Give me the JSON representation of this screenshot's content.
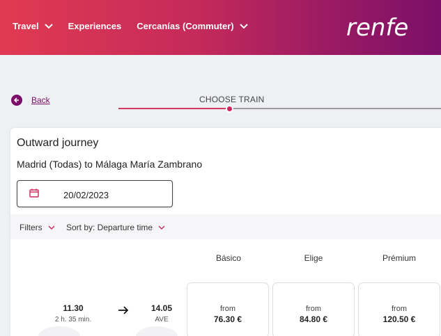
{
  "nav": {
    "items": [
      {
        "label": "Travel",
        "has_dropdown": true
      },
      {
        "label": "Experiences",
        "has_dropdown": false
      },
      {
        "label": "Cercanías (Commuter)",
        "has_dropdown": true
      }
    ],
    "logo": "renfe"
  },
  "progress": {
    "back_label": "Back",
    "step_title": "CHOOSE TRAIN"
  },
  "journey": {
    "title": "Outward journey",
    "route": "Madrid (Todas) to Málaga María Zambrano",
    "date": "20/02/2023"
  },
  "filters": {
    "filters_label": "Filters",
    "sort_label": "Sort by: Departure time"
  },
  "fares": {
    "headers": [
      "Básico",
      "Elige",
      "Prémium"
    ],
    "from_label": "from",
    "prices": [
      "76.30 €",
      "84.80 €",
      "120.50 €"
    ]
  },
  "train": {
    "departure": "11.30",
    "duration": "2 h. 35 min.",
    "arrival": "14.05",
    "type": "AVE"
  },
  "colors": {
    "brand_purple": "#7b0f69",
    "brand_red": "#e13a52",
    "accent": "#d0255a"
  }
}
